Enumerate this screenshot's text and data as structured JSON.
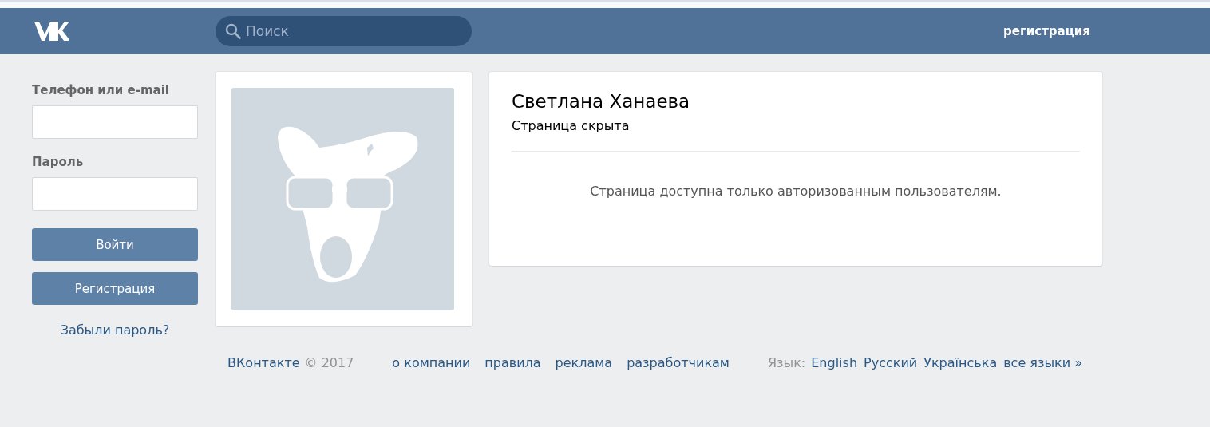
{
  "header": {
    "search": {
      "placeholder": "Поиск"
    },
    "register_link": "регистрация"
  },
  "login": {
    "phone_label": "Телефон или e-mail",
    "password_label": "Пароль",
    "buttons": [
      {
        "label": "Войти"
      },
      {
        "label": "Регистрация"
      }
    ],
    "forgot_link": "Забыли пароль?"
  },
  "profile": {
    "name": "Светлана Ханаева",
    "status": "Страница скрыта",
    "message": "Страница доступна только авторизованным пользователям."
  },
  "footer": {
    "brand": "ВКонтакте",
    "copyright": "© 2017",
    "links": [
      "о компании",
      "правила",
      "реклама",
      "разработчикам"
    ],
    "language_label": "Язык:",
    "languages": [
      "English",
      "Русский",
      "Українська",
      "все языки »"
    ]
  }
}
